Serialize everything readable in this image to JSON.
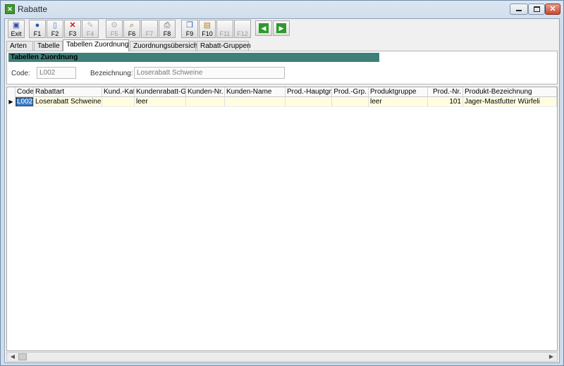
{
  "window": {
    "title": "Rabatte"
  },
  "toolbar": {
    "buttons": [
      {
        "label": "Exit",
        "icon": "exit-icon",
        "enabled": true
      },
      {
        "label": "F1",
        "icon": "help-icon",
        "enabled": true
      },
      {
        "label": "F2",
        "icon": "new-document-icon",
        "enabled": true
      },
      {
        "label": "F3",
        "icon": "delete-icon",
        "enabled": true
      },
      {
        "label": "F4",
        "icon": "edit-icon",
        "enabled": false
      },
      {
        "label": "F5",
        "icon": "tools-icon",
        "enabled": false
      },
      {
        "label": "F6",
        "icon": "search-icon",
        "enabled": true
      },
      {
        "label": "F7",
        "icon": "blank-icon",
        "enabled": false
      },
      {
        "label": "F8",
        "icon": "print-icon",
        "enabled": true
      },
      {
        "label": "F9",
        "icon": "copy-icon",
        "enabled": true
      },
      {
        "label": "F10",
        "icon": "paste-icon",
        "enabled": true
      },
      {
        "label": "F11",
        "icon": "blank-icon",
        "enabled": false
      },
      {
        "label": "F12",
        "icon": "blank-icon",
        "enabled": false
      }
    ]
  },
  "tabs": [
    {
      "label": "Arten"
    },
    {
      "label": "Tabelle"
    },
    {
      "label": "Tabellen Zuordnung"
    },
    {
      "label": "Zuordnungsübersicht"
    },
    {
      "label": "Rabatt-Gruppen"
    }
  ],
  "panel": {
    "section_title": "Tabellen Zuordnung",
    "code_label": "Code:",
    "code_value": "L002",
    "bez_label": "Bezeichnung:",
    "bez_value": "Loserabatt Schweine"
  },
  "grid": {
    "columns": [
      "Code",
      "Rabattart",
      "Kund.-Kate",
      "Kundenrabatt-Gr",
      "Kunden-Nr.",
      "Kunden-Name",
      "Prod.-Hauptgr.",
      "Prod.-Grp.",
      "Produktgruppe",
      "Prod.-Nr.",
      "Produkt-Bezeichnung"
    ],
    "rows": [
      [
        "L002",
        "Loserabatt Schweine",
        "",
        "leer",
        "",
        "",
        "",
        "",
        "leer",
        "101",
        "Jager-Mastfutter Würfeli"
      ]
    ]
  },
  "colors": {
    "section_header": "#3f7f7a",
    "row_highlight": "#fffde0",
    "selection": "#3d7fc8"
  }
}
